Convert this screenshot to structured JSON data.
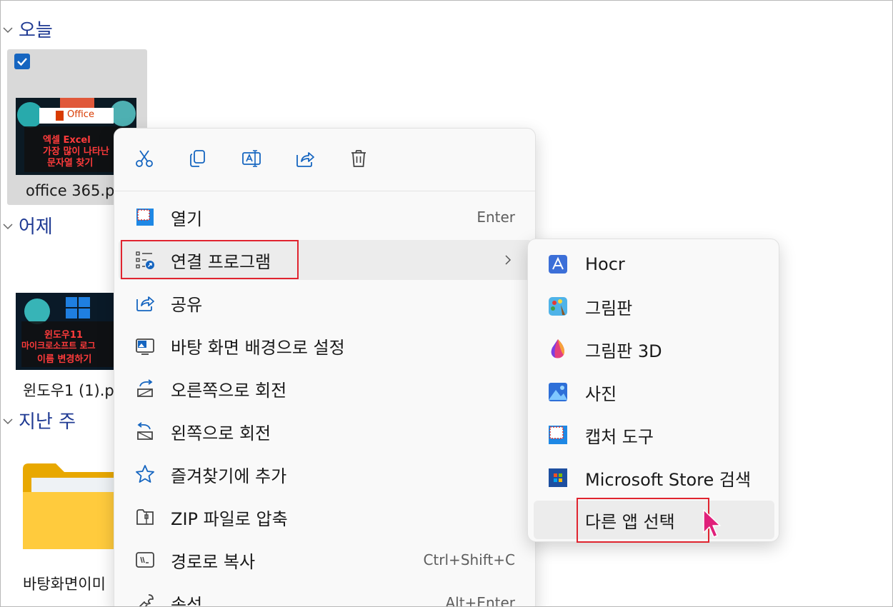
{
  "groups": {
    "today": "오늘",
    "yesterday": "어제",
    "last_week": "지난 주"
  },
  "files": [
    {
      "name": "office 365.p",
      "thumb_brand": "Office",
      "thumb_lines": [
        "엑셀 Excel",
        "가장 많이 나타난",
        "문자열 찾기"
      ]
    },
    {
      "name": "윈도우1 (1).p",
      "thumb_lines": [
        "윈도우11",
        "마이크로소프트 로그",
        "이름 변경하기"
      ]
    },
    {
      "name": "바탕화면이미"
    }
  ],
  "toolbar": {
    "cut_icon": "scissors-icon",
    "copy_icon": "copy-icon",
    "rename_icon": "rename-icon",
    "share_icon": "share-icon",
    "delete_icon": "trash-icon"
  },
  "menu": [
    {
      "label": "열기",
      "shortcut": "Enter",
      "icon": "open-icon"
    },
    {
      "label": "연결 프로그램",
      "shortcut": "",
      "icon": "open-with-icon",
      "submenu": true
    },
    {
      "label": "공유",
      "shortcut": "",
      "icon": "share-icon"
    },
    {
      "label": "바탕 화면 배경으로 설정",
      "shortcut": "",
      "icon": "wallpaper-icon"
    },
    {
      "label": "오른쪽으로 회전",
      "shortcut": "",
      "icon": "rotate-right-icon"
    },
    {
      "label": "왼쪽으로 회전",
      "shortcut": "",
      "icon": "rotate-left-icon"
    },
    {
      "label": "즐겨찾기에 추가",
      "shortcut": "",
      "icon": "star-icon"
    },
    {
      "label": "ZIP 파일로 압축",
      "shortcut": "",
      "icon": "zip-icon"
    },
    {
      "label": "경로로 복사",
      "shortcut": "Ctrl+Shift+C",
      "icon": "copy-path-icon"
    },
    {
      "label": "속성",
      "shortcut": "Alt+Enter",
      "icon": "wrench-icon"
    }
  ],
  "submenu": [
    {
      "label": "Hocr",
      "icon": "hocr-app-icon"
    },
    {
      "label": "그림판",
      "icon": "paint-app-icon"
    },
    {
      "label": "그림판 3D",
      "icon": "paint3d-app-icon"
    },
    {
      "label": "사진",
      "icon": "photos-app-icon"
    },
    {
      "label": "캡처 도구",
      "icon": "snipping-tool-icon"
    },
    {
      "label": "Microsoft Store 검색",
      "icon": "store-icon"
    },
    {
      "label": "다른 앱 선택",
      "icon": ""
    }
  ]
}
